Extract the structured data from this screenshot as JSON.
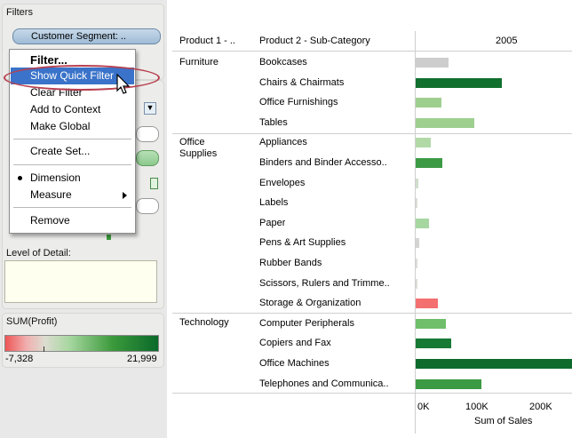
{
  "filters_card": {
    "title": "Filters",
    "pill_label": "Customer Segment: .."
  },
  "context_menu": {
    "items": [
      {
        "label": "Filter...",
        "bold": true
      },
      {
        "label": "Show Quick Filter",
        "highlighted": true
      },
      {
        "label": "Clear Filter"
      },
      {
        "label": "Add to Context"
      },
      {
        "label": "Make Global"
      },
      {
        "label": "Create Set..."
      },
      {
        "label": "Dimension",
        "selected": true
      },
      {
        "label": "Measure",
        "submenu": true
      },
      {
        "label": "Remove"
      }
    ]
  },
  "marks_card": {
    "level_of_detail_label": "Level of Detail:"
  },
  "legend": {
    "title": "SUM(Profit)",
    "min_label": "-7,328",
    "max_label": "21,999",
    "min_color": "#ee5555",
    "max_color": "#0a6a2a"
  },
  "table": {
    "headers": {
      "col1": "Product 1 - ..",
      "col2": "Product 2 - Sub-Category",
      "col3": "2005"
    },
    "groups": [
      {
        "name": "Furniture",
        "rows": [
          {
            "label": "Bookcases"
          },
          {
            "label": "Chairs & Chairmats"
          },
          {
            "label": "Office Furnishings"
          },
          {
            "label": "Tables"
          }
        ]
      },
      {
        "name": "Office\nSupplies",
        "rows": [
          {
            "label": "Appliances"
          },
          {
            "label": "Binders and Binder Accesso.."
          },
          {
            "label": "Envelopes"
          },
          {
            "label": "Labels"
          },
          {
            "label": "Paper"
          },
          {
            "label": "Pens & Art Supplies"
          },
          {
            "label": "Rubber Bands"
          },
          {
            "label": "Scissors, Rulers and Trimme.."
          },
          {
            "label": "Storage & Organization"
          }
        ]
      },
      {
        "name": "Technology",
        "rows": [
          {
            "label": "Computer Peripherals"
          },
          {
            "label": "Copiers and Fax"
          },
          {
            "label": "Office Machines"
          },
          {
            "label": "Telephones and Communica.."
          }
        ]
      }
    ],
    "axis_ticks": [
      "0K",
      "100K",
      "200K"
    ],
    "axis_label": "Sum of Sales"
  },
  "chart_data": {
    "type": "bar",
    "categories": [
      "Bookcases",
      "Chairs & Chairmats",
      "Office Furnishings",
      "Tables",
      "Appliances",
      "Binders and Binder Accesso..",
      "Envelopes",
      "Labels",
      "Paper",
      "Pens & Art Supplies",
      "Rubber Bands",
      "Scissors, Rulers and Trimme..",
      "Storage & Organization",
      "Computer Peripherals",
      "Copiers and Fax",
      "Office Machines",
      "Telephones and Communica.."
    ],
    "values": [
      52000,
      135000,
      40000,
      92000,
      24000,
      42000,
      4000,
      1000,
      21000,
      5000,
      1000,
      1000,
      35000,
      47000,
      55000,
      255000,
      103000
    ],
    "colors": [
      "#cdcdcd",
      "#11702e",
      "#9ecf8f",
      "#9ecf8f",
      "#b1d9a6",
      "#3c9a44",
      "#cfdecb",
      "#dcdcd8",
      "#a7d7a0",
      "#d4d4d0",
      "#dcdcd8",
      "#dcdcd8",
      "#f47070",
      "#6fbf6a",
      "#177a34",
      "#0e6b2c",
      "#3c9a44"
    ],
    "xlabel": "Sum of Sales",
    "xlim": [
      0,
      200000
    ]
  }
}
